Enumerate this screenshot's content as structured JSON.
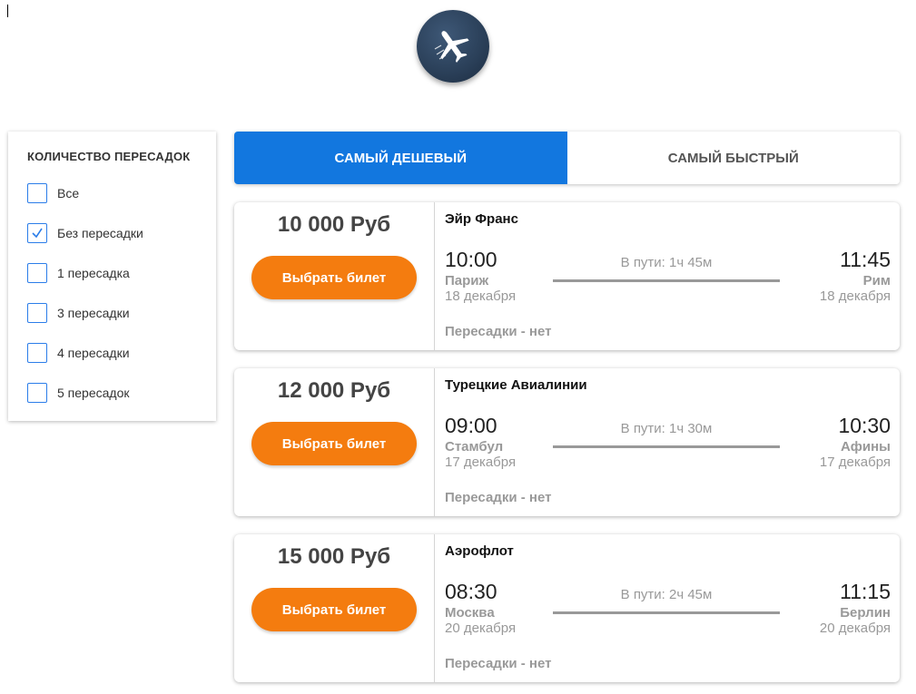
{
  "filters": {
    "title": "КОЛИЧЕСТВО ПЕРЕСАДОК",
    "options": [
      {
        "label": "Все",
        "checked": false
      },
      {
        "label": "Без пересадки",
        "checked": true
      },
      {
        "label": "1 пересадка",
        "checked": false
      },
      {
        "label": "3 пересадки",
        "checked": false
      },
      {
        "label": "4 пересадки",
        "checked": false
      },
      {
        "label": "5 пересадок",
        "checked": false
      }
    ]
  },
  "tabs": [
    {
      "label": "САМЫЙ ДЕШЕВЫЙ",
      "active": true
    },
    {
      "label": "САМЫЙ БЫСТРЫЙ",
      "active": false
    }
  ],
  "colors": {
    "accent": "#1277df",
    "button": "#f47c0f",
    "logo": "#2a3f58"
  },
  "icons": {
    "logo": "airplane-icon",
    "check": "checkmark-icon"
  },
  "tickets": [
    {
      "price": "10 000 Руб",
      "button_label": "Выбрать билет",
      "airline": "Эйр Франс",
      "departure_time": "10:00",
      "departure_city": "Париж",
      "departure_date": "18 декабря",
      "duration": "В пути: 1ч 45м",
      "arrival_time": "11:45",
      "arrival_city": "Рим",
      "arrival_date": "18 декабря",
      "stops": "Пересадки - нет"
    },
    {
      "price": "12 000 Руб",
      "button_label": "Выбрать билет",
      "airline": "Турецкие Авиалинии",
      "departure_time": "09:00",
      "departure_city": "Стамбул",
      "departure_date": "17 декабря",
      "duration": "В пути: 1ч 30м",
      "arrival_time": "10:30",
      "arrival_city": "Афины",
      "arrival_date": "17 декабря",
      "stops": "Пересадки - нет"
    },
    {
      "price": "15 000 Руб",
      "button_label": "Выбрать билет",
      "airline": "Аэрофлот",
      "departure_time": "08:30",
      "departure_city": "Москва",
      "departure_date": "20 декабря",
      "duration": "В пути: 2ч 45м",
      "arrival_time": "11:15",
      "arrival_city": "Берлин",
      "arrival_date": "20 декабря",
      "stops": "Пересадки - нет"
    }
  ]
}
